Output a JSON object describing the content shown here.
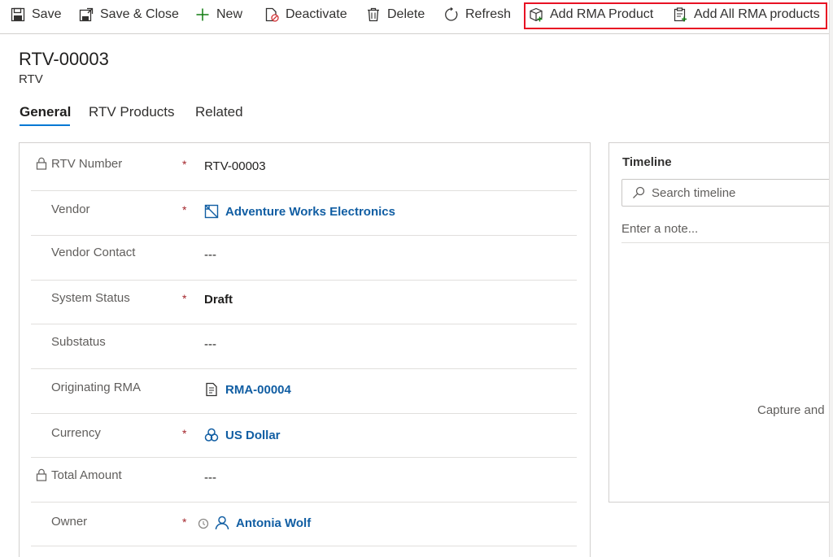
{
  "toolbar": {
    "save": "Save",
    "save_close": "Save & Close",
    "new": "New",
    "deactivate": "Deactivate",
    "delete": "Delete",
    "refresh": "Refresh",
    "add_rma_product": "Add RMA Product",
    "add_all_rma_products": "Add All RMA products"
  },
  "record": {
    "title": "RTV-00003",
    "entity": "RTV"
  },
  "tabs": [
    {
      "label": "General",
      "active": true
    },
    {
      "label": "RTV Products",
      "active": false
    },
    {
      "label": "Related",
      "active": false
    }
  ],
  "fields": {
    "rtv_number": {
      "label": "RTV Number",
      "value": "RTV-00003",
      "required": "*"
    },
    "vendor": {
      "label": "Vendor",
      "value": "Adventure Works Electronics",
      "required": "*"
    },
    "vendor_contact": {
      "label": "Vendor Contact",
      "value": "---"
    },
    "system_status": {
      "label": "System Status",
      "value": "Draft",
      "required": "*"
    },
    "substatus": {
      "label": "Substatus",
      "value": "---"
    },
    "originating_rma": {
      "label": "Originating RMA",
      "value": "RMA-00004"
    },
    "currency": {
      "label": "Currency",
      "value": "US Dollar",
      "required": "*"
    },
    "total_amount": {
      "label": "Total Amount",
      "value": "---"
    },
    "owner": {
      "label": "Owner",
      "value": "Antonia Wolf",
      "required": "*"
    }
  },
  "timeline": {
    "title": "Timeline",
    "search_placeholder": "Search timeline",
    "note_placeholder": "Enter a note...",
    "empty_text": "Capture and"
  },
  "colors": {
    "accent": "#0078d4",
    "link": "#115ea3",
    "required": "#a4262c",
    "highlight_box": "#e81123"
  }
}
